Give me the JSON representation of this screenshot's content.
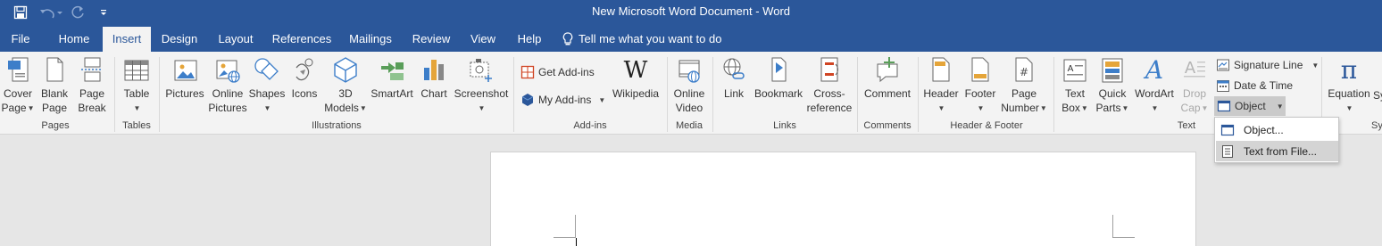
{
  "window": {
    "title": "New Microsoft Word Document  -  Word"
  },
  "quick_access": {
    "save_icon": "save-icon",
    "undo_icon": "undo-icon",
    "redo_icon": "redo-icon",
    "customize_icon": "customize-qat-icon"
  },
  "tabs": [
    "File",
    "Home",
    "Insert",
    "Design",
    "Layout",
    "References",
    "Mailings",
    "Review",
    "View",
    "Help"
  ],
  "active_tab": "Insert",
  "tell_me": "Tell me what you want to do",
  "ribbon": {
    "pages": {
      "cover": "Cover",
      "cover2": "Page",
      "blank": "Blank",
      "blank2": "Page",
      "break": "Page",
      "break2": "Break",
      "label": "Pages"
    },
    "tables": {
      "table": "Table",
      "label": "Tables"
    },
    "illustrations": {
      "pictures": "Pictures",
      "online": "Online",
      "online2": "Pictures",
      "shapes": "Shapes",
      "icons": "Icons",
      "models": "3D",
      "models2": "Models",
      "smartart": "SmartArt",
      "chart": "Chart",
      "screenshot": "Screenshot",
      "label": "Illustrations"
    },
    "addins": {
      "get": "Get Add-ins",
      "my": "My Add-ins",
      "wikipedia": "Wikipedia",
      "label": "Add-ins"
    },
    "media": {
      "video": "Online",
      "video2": "Video",
      "label": "Media"
    },
    "links": {
      "link": "Link",
      "bookmark": "Bookmark",
      "cross": "Cross-",
      "cross2": "reference",
      "label": "Links"
    },
    "comments": {
      "comment": "Comment",
      "label": "Comments"
    },
    "header_footer": {
      "header": "Header",
      "footer": "Footer",
      "number": "Page",
      "number2": "Number",
      "label": "Header & Footer"
    },
    "text": {
      "textbox": "Text",
      "textbox2": "Box",
      "quickparts": "Quick",
      "quickparts2": "Parts",
      "wordart": "WordArt",
      "dropcap": "Drop",
      "dropcap2": "Cap",
      "signature": "Signature Line",
      "datetime": "Date & Time",
      "object": "Object",
      "label": "Text"
    },
    "symbols": {
      "equation": "Equation",
      "symbol_partial": "Sy",
      "label_partial": "Sy"
    }
  },
  "object_menu": [
    {
      "label": "Object..."
    },
    {
      "label": "Text from File..."
    }
  ],
  "colors": {
    "accent": "#2b579a",
    "ribbon": "#f3f3f3",
    "canvas": "#e6e6e6"
  }
}
